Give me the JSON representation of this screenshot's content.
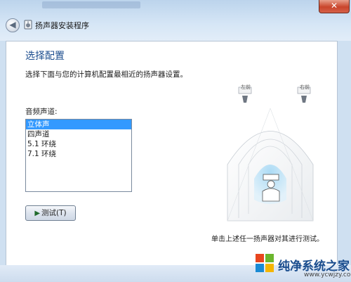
{
  "window": {
    "title": "扬声器安装程序",
    "close_glyph": "✕",
    "back_glyph": "◀"
  },
  "content": {
    "heading": "选择配置",
    "description": "选择下面与您的计算机配置最相近的扬声器设置。",
    "audio_channels_label": "音频声道:",
    "channel_options": [
      "立体声",
      "四声道",
      "5.1 环绕",
      "7.1 环绕"
    ],
    "selected_index": 0,
    "test_button_label": "测试(T)",
    "hint": "单击上述任一扬声器对其进行测试。"
  },
  "diagram": {
    "left_label": "左前",
    "right_label": "右前"
  },
  "watermark": {
    "title": "纯净系统之家",
    "url": "www.ycwjzy.com"
  },
  "colors": {
    "heading": "#1d4e8f",
    "selection": "#3399ff",
    "close": "#c9452b"
  }
}
